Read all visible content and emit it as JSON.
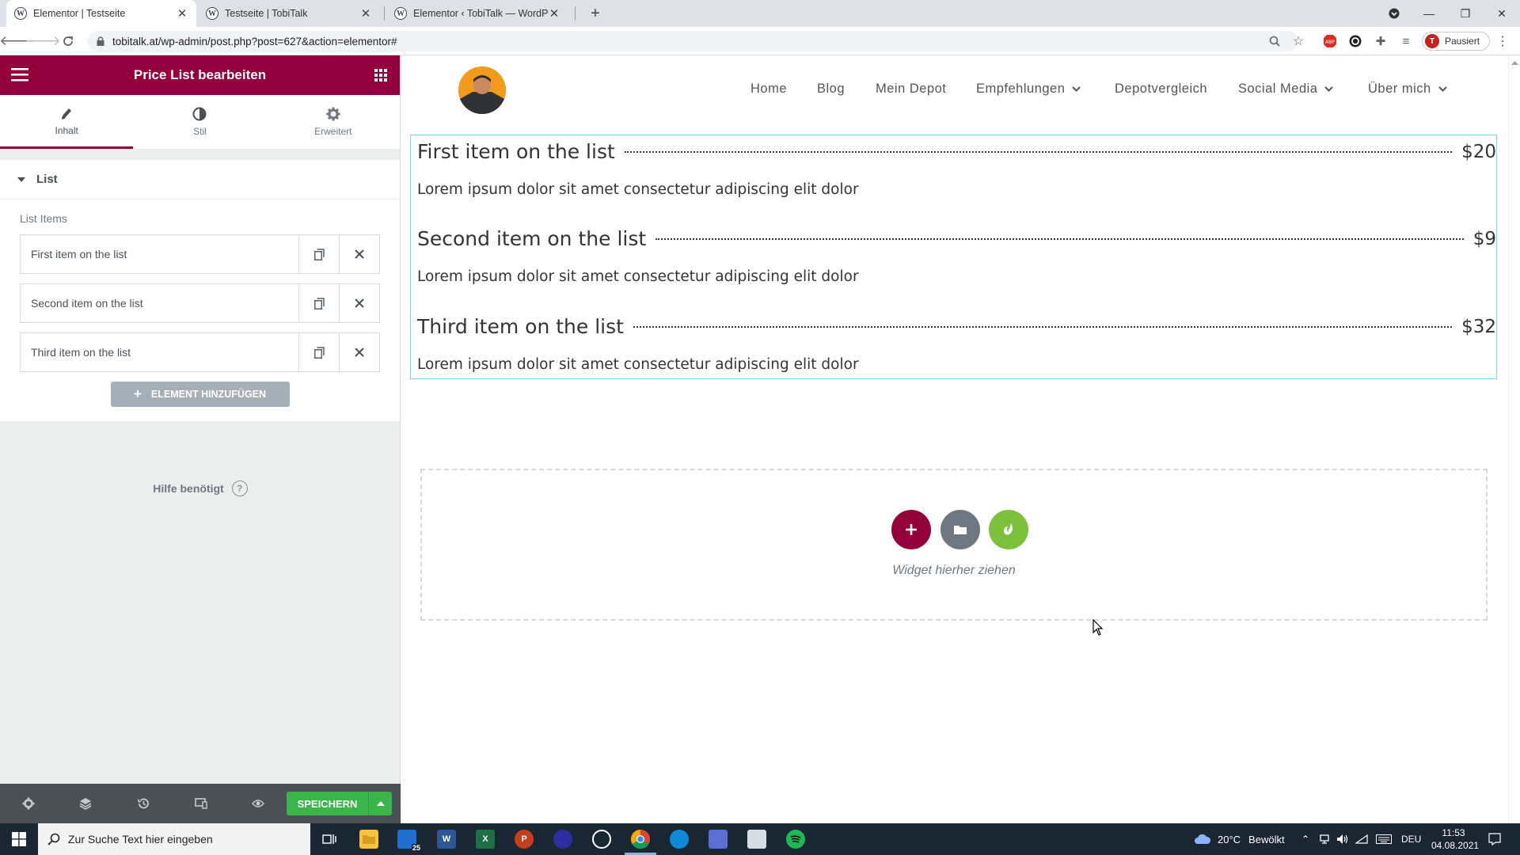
{
  "browser": {
    "tabs": [
      {
        "title": "Elementor | Testseite",
        "active": true
      },
      {
        "title": "Testseite | TobiTalk",
        "active": false
      },
      {
        "title": "Elementor ‹ TobiTalk — WordPre",
        "active": false
      }
    ],
    "url": "tobitalk.at/wp-admin/post.php?post=627&action=elementor#",
    "profile_initial": "T",
    "profile_label": "Pausiert"
  },
  "panel": {
    "title": "Price List bearbeiten",
    "tabs": [
      {
        "label": "Inhalt",
        "icon": "pencil-icon",
        "active": true
      },
      {
        "label": "Stil",
        "icon": "half-circle-icon",
        "active": false
      },
      {
        "label": "Erweitert",
        "icon": "gear-icon",
        "active": false
      }
    ],
    "section_title": "List",
    "list_label": "List Items",
    "items": [
      {
        "name": "First item on the list"
      },
      {
        "name": "Second item on the list"
      },
      {
        "name": "Third item on the list"
      }
    ],
    "add_button": "ELEMENT HINZUFÜGEN",
    "help_text": "Hilfe benötigt",
    "save_button": "SPEICHERN",
    "accent_color": "#93003c",
    "save_color": "#39b54a"
  },
  "site": {
    "nav": [
      {
        "label": "Home",
        "dropdown": false
      },
      {
        "label": "Blog",
        "dropdown": false
      },
      {
        "label": "Mein Depot",
        "dropdown": false
      },
      {
        "label": "Empfehlungen",
        "dropdown": true
      },
      {
        "label": "Depotvergleich",
        "dropdown": false
      },
      {
        "label": "Social Media",
        "dropdown": true
      },
      {
        "label": "Über mich",
        "dropdown": true
      }
    ],
    "price_list": [
      {
        "title": "First item on the list",
        "price": "$20",
        "description": "Lorem ipsum dolor sit amet consectetur adipiscing elit dolor"
      },
      {
        "title": "Second item on the list",
        "price": "$9",
        "description": "Lorem ipsum dolor sit amet consectetur adipiscing elit dolor"
      },
      {
        "title": "Third item on the list",
        "price": "$32",
        "description": "Lorem ipsum dolor sit amet consectetur adipiscing elit dolor"
      }
    ],
    "dropzone_text": "Widget hierher ziehen"
  },
  "taskbar": {
    "search_placeholder": "Zur Suche Text hier eingeben",
    "weather": "20°C",
    "weather_text": "Bewölkt",
    "language": "DEU",
    "time": "11:53",
    "date": "04.08.2021",
    "mail_badge": "25"
  }
}
